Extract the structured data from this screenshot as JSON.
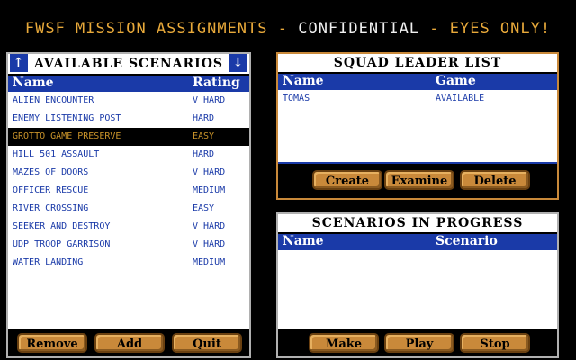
{
  "title": {
    "left": "FWSF MISSION ASSIGNMENTS - ",
    "middle": "CONFIDENTIAL",
    "right": " - EYES ONLY!"
  },
  "available": {
    "header": "AVAILABLE SCENARIOS",
    "col_name": "Name",
    "col_rating": "Rating",
    "up_icon": "up-arrow-icon",
    "down_icon": "down-arrow-icon",
    "rows": [
      {
        "name": "ALIEN ENCOUNTER",
        "rating": "V HARD"
      },
      {
        "name": "ENEMY LISTENING POST",
        "rating": "HARD"
      },
      {
        "name": "GROTTO GAME PRESERVE",
        "rating": "EASY"
      },
      {
        "name": "HILL 501 ASSAULT",
        "rating": "HARD"
      },
      {
        "name": "MAZES OF DOORS",
        "rating": "V HARD"
      },
      {
        "name": "OFFICER RESCUE",
        "rating": "MEDIUM"
      },
      {
        "name": "RIVER CROSSING",
        "rating": "EASY"
      },
      {
        "name": "SEEKER AND DESTROY",
        "rating": "V HARD"
      },
      {
        "name": "UDP TROOP GARRISON",
        "rating": "V HARD"
      },
      {
        "name": "WATER LANDING",
        "rating": "MEDIUM"
      }
    ],
    "buttons": {
      "remove": "Remove",
      "add": "Add",
      "quit": "Quit"
    }
  },
  "squad": {
    "header": "SQUAD LEADER LIST",
    "col_name": "Name",
    "col_game": "Game",
    "rows": [
      {
        "name": "TOMAS",
        "game": "AVAILABLE"
      }
    ],
    "buttons": {
      "create": "Create",
      "examine": "Examine",
      "delete": "Delete"
    }
  },
  "progress": {
    "header": "SCENARIOS IN PROGRESS",
    "col_name": "Name",
    "col_scenario": "Scenario",
    "buttons": {
      "make": "Make",
      "play": "Play",
      "stop": "Stop"
    }
  }
}
